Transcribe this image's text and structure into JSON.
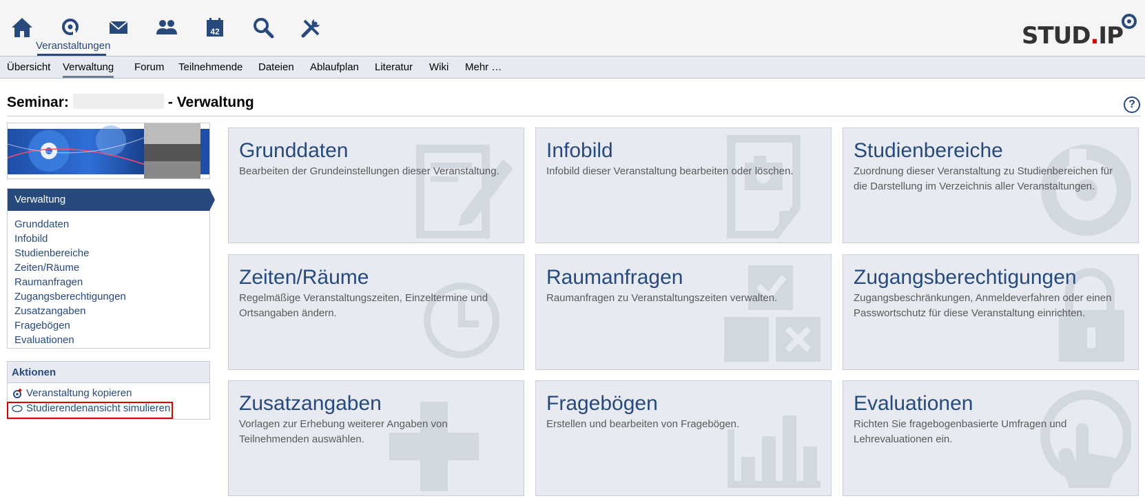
{
  "header": {
    "nav_icons": [
      "home-icon",
      "courses-icon",
      "mail-icon",
      "community-icon",
      "calendar-icon",
      "search-icon",
      "tools-icon"
    ],
    "calendar_day": "42",
    "active_nav_label": "Veranstaltungen",
    "logo": {
      "part1": "STUD",
      "dot": ".",
      "part2": "IP"
    }
  },
  "tabs": [
    {
      "label": "Übersicht"
    },
    {
      "label": "Verwaltung"
    },
    {
      "label": "Forum"
    },
    {
      "label": "Teilnehmende"
    },
    {
      "label": "Dateien"
    },
    {
      "label": "Ablaufplan"
    },
    {
      "label": "Literatur"
    },
    {
      "label": "Wiki"
    },
    {
      "label": "Mehr …"
    }
  ],
  "page": {
    "title_prefix": "Seminar:",
    "title_suffix": "- Verwaltung",
    "help": "?"
  },
  "sidebar": {
    "heading": "Verwaltung",
    "items": [
      {
        "label": "Grunddaten"
      },
      {
        "label": "Infobild"
      },
      {
        "label": "Studienbereiche"
      },
      {
        "label": "Zeiten/Räume"
      },
      {
        "label": "Raumanfragen"
      },
      {
        "label": "Zugangsberechtigungen"
      },
      {
        "label": "Zusatzangaben"
      },
      {
        "label": "Fragebögen"
      },
      {
        "label": "Evaluationen"
      }
    ]
  },
  "actions": {
    "heading": "Aktionen",
    "items": [
      {
        "label": "Veranstaltung kopieren",
        "icon": "copy-course-icon"
      },
      {
        "label": "Studierendenansicht simulieren",
        "icon": "eye-icon"
      }
    ]
  },
  "tiles": [
    {
      "title": "Grunddaten",
      "desc": "Bearbeiten der Grundeinstellungen dieser Veranstaltung.",
      "icon": "edit-document-icon"
    },
    {
      "title": "Infobild",
      "desc": "Infobild dieser Veranstaltung bearbeiten oder löschen.",
      "icon": "image-document-icon"
    },
    {
      "title": "Studienbereiche",
      "desc": "Zuordnung dieser Veranstaltung zu Studienbereichen für die Darstellung im Verzeichnis aller Veranstaltungen.",
      "icon": "study-area-icon"
    },
    {
      "title": "Zeiten/Räume",
      "desc": "Regelmäßige Veranstaltungszeiten, Einzeltermine und Ortsangaben ändern.",
      "icon": "clock-icon"
    },
    {
      "title": "Raumanfragen",
      "desc": "Raumanfragen zu Veranstaltungszeiten verwalten.",
      "icon": "room-request-icon"
    },
    {
      "title": "Zugangsberechtigungen",
      "desc": "Zugangsbeschränkungen, Anmeldeverfahren oder einen Passwortschutz für diese Veranstaltung einrichten.",
      "icon": "lock-icon"
    },
    {
      "title": "Zusatzangaben",
      "desc": "Vorlagen zur Erhebung weiterer Angaben von Teilnehmenden auswählen.",
      "icon": "plus-icon"
    },
    {
      "title": "Fragebögen",
      "desc": "Erstellen und bearbeiten von Fragebögen.",
      "icon": "bar-chart-icon"
    },
    {
      "title": "Evaluationen",
      "desc": "Richten Sie fragebogenbasierte Umfragen und Lehrevaluationen ein.",
      "icon": "evaluation-icon"
    }
  ],
  "colors": {
    "brand": "#28497c",
    "tile_bg": "#e7ebf1",
    "highlight": "#d60000"
  }
}
